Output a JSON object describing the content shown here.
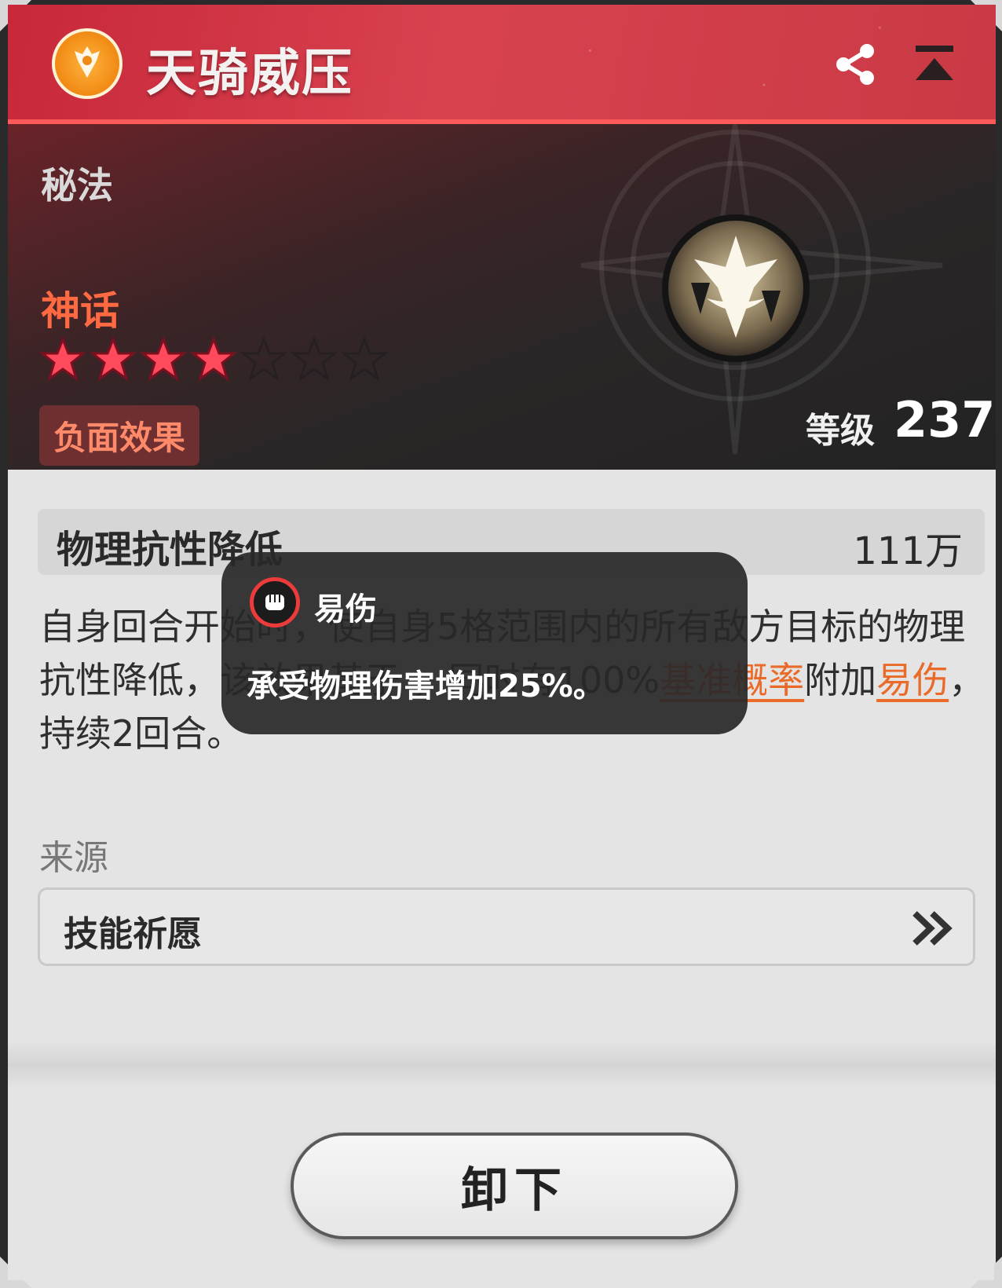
{
  "header": {
    "title": "天骑威压",
    "share_icon": "share-icon",
    "collapse_icon": "collapse-icon"
  },
  "hero": {
    "category": "秘法",
    "rarity": "神话",
    "stars_filled": 4,
    "stars_total": 7,
    "tag": "负面效果",
    "level_label": "等级",
    "level_value": "237"
  },
  "stat": {
    "name": "物理抗性降低",
    "value": "111万"
  },
  "description": {
    "part1": "自身回合开始时，使自身5格范围内的所有敌方目标的物理抗性降低，该效果基于 ，同时有100%",
    "kw1": "基准概率",
    "part2": "附加",
    "kw2": "易伤",
    "part3": "，持续2回合。"
  },
  "source": {
    "label": "来源",
    "item": "技能祈愿"
  },
  "action": {
    "unequip": "卸下"
  },
  "tooltip": {
    "title": "易伤",
    "text": "承受物理伤害增加25%。"
  },
  "colors": {
    "header_red": "#d8424f",
    "keyword_orange": "#ea6a2a",
    "rarity_orange": "#ff6a43",
    "star_pink": "#ff4a5e"
  }
}
